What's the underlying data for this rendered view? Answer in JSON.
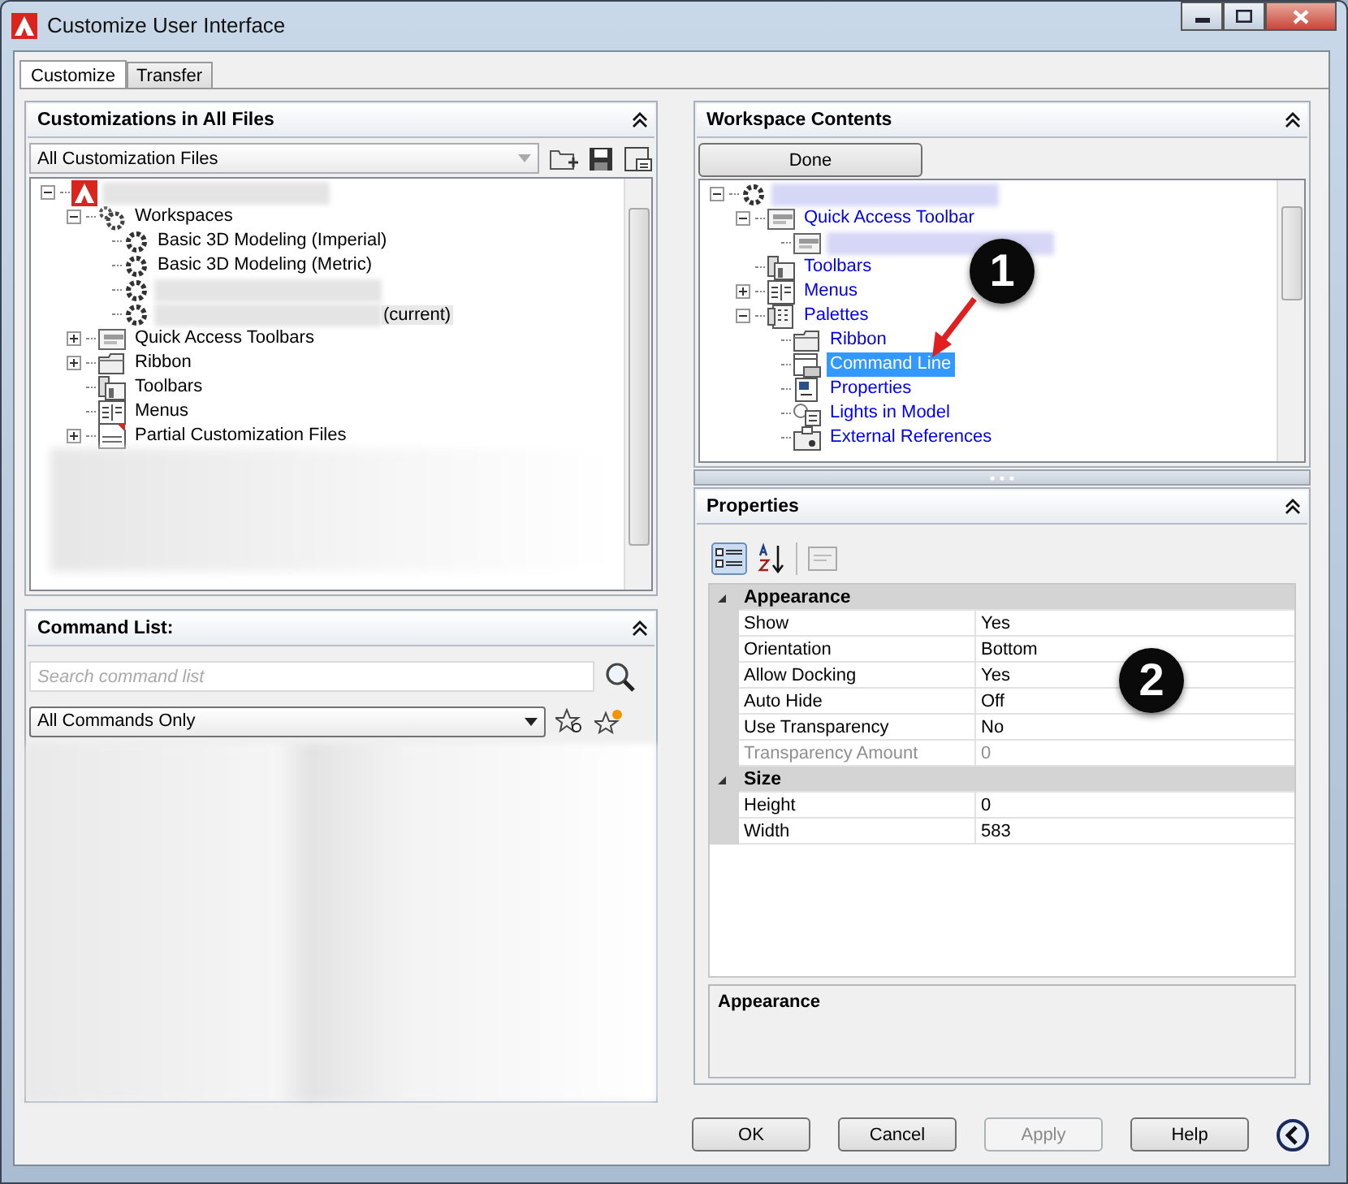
{
  "window": {
    "title": "Customize User Interface"
  },
  "tabs": [
    {
      "label": "Customize",
      "selected": true
    },
    {
      "label": "Transfer",
      "selected": false
    }
  ],
  "customizations": {
    "title": "Customizations in All Files",
    "filter": "All Customization Files",
    "tree": [
      {
        "kind": "app",
        "blurred": true,
        "expanded": true,
        "children": [
          {
            "kind": "gears",
            "label": "Workspaces",
            "expanded": true,
            "children": [
              {
                "kind": "gear",
                "label": "Basic 3D Modeling (Imperial)"
              },
              {
                "kind": "gear",
                "label": "Basic 3D Modeling (Metric)"
              },
              {
                "kind": "gear",
                "blurred": true
              },
              {
                "kind": "gear",
                "blurred": true,
                "suffix": "(current)"
              }
            ]
          },
          {
            "kind": "qat",
            "label": "Quick Access Toolbars",
            "expanded": false
          },
          {
            "kind": "ribbon",
            "label": "Ribbon",
            "expanded": false
          },
          {
            "kind": "toolbars",
            "label": "Toolbars"
          },
          {
            "kind": "menus",
            "label": "Menus"
          },
          {
            "kind": "cui",
            "label": "Partial Customization Files",
            "expanded": false
          }
        ]
      }
    ]
  },
  "command_list": {
    "title": "Command List:",
    "search": {
      "placeholder": "Search command list"
    },
    "filter": "All Commands Only"
  },
  "workspace_contents": {
    "title": "Workspace Contents",
    "done": "Done",
    "tree": [
      {
        "kind": "gear",
        "blurred": true,
        "selected": false,
        "expanded": true,
        "children": [
          {
            "kind": "qat",
            "label": "Quick Access Toolbar",
            "selected": false,
            "expanded": true,
            "children": [
              {
                "kind": "qat",
                "blurred": true,
                "selected": false
              }
            ]
          },
          {
            "kind": "toolbars",
            "label": "Toolbars",
            "selected": false
          },
          {
            "kind": "menus",
            "label": "Menus",
            "selected": false,
            "expanded": false
          },
          {
            "kind": "palettes",
            "label": "Palettes",
            "selected": false,
            "expanded": true,
            "children": [
              {
                "kind": "ribbon",
                "label": "Ribbon",
                "selected": false
              },
              {
                "kind": "cmdline",
                "label": "Command Line",
                "selected": true
              },
              {
                "kind": "properties",
                "label": "Properties",
                "selected": false
              },
              {
                "kind": "lights",
                "label": "Lights in Model",
                "selected": false
              },
              {
                "kind": "xref",
                "label": "External References",
                "selected": false
              }
            ]
          }
        ]
      }
    ]
  },
  "properties": {
    "title": "Properties",
    "categories": [
      {
        "name": "Appearance",
        "expanded": true,
        "rows": [
          {
            "name": "Show",
            "value": "Yes",
            "disabled": false
          },
          {
            "name": "Orientation",
            "value": "Bottom",
            "disabled": false
          },
          {
            "name": "Allow Docking",
            "value": "Yes",
            "disabled": false
          },
          {
            "name": "Auto Hide",
            "value": "Off",
            "disabled": false
          },
          {
            "name": "Use Transparency",
            "value": "No",
            "disabled": false
          },
          {
            "name": "Transparency Amount",
            "value": "0",
            "disabled": true
          }
        ]
      },
      {
        "name": "Size",
        "expanded": true,
        "rows": [
          {
            "name": "Height",
            "value": "0",
            "disabled": false
          },
          {
            "name": "Width",
            "value": "583",
            "disabled": false
          }
        ]
      }
    ],
    "description": "Appearance"
  },
  "callouts": [
    {
      "label": "1"
    },
    {
      "label": "2"
    }
  ],
  "buttons": [
    {
      "label": "OK",
      "disabled": false
    },
    {
      "label": "Cancel",
      "disabled": false
    },
    {
      "label": "Apply",
      "disabled": true
    },
    {
      "label": "Help",
      "disabled": false
    }
  ]
}
